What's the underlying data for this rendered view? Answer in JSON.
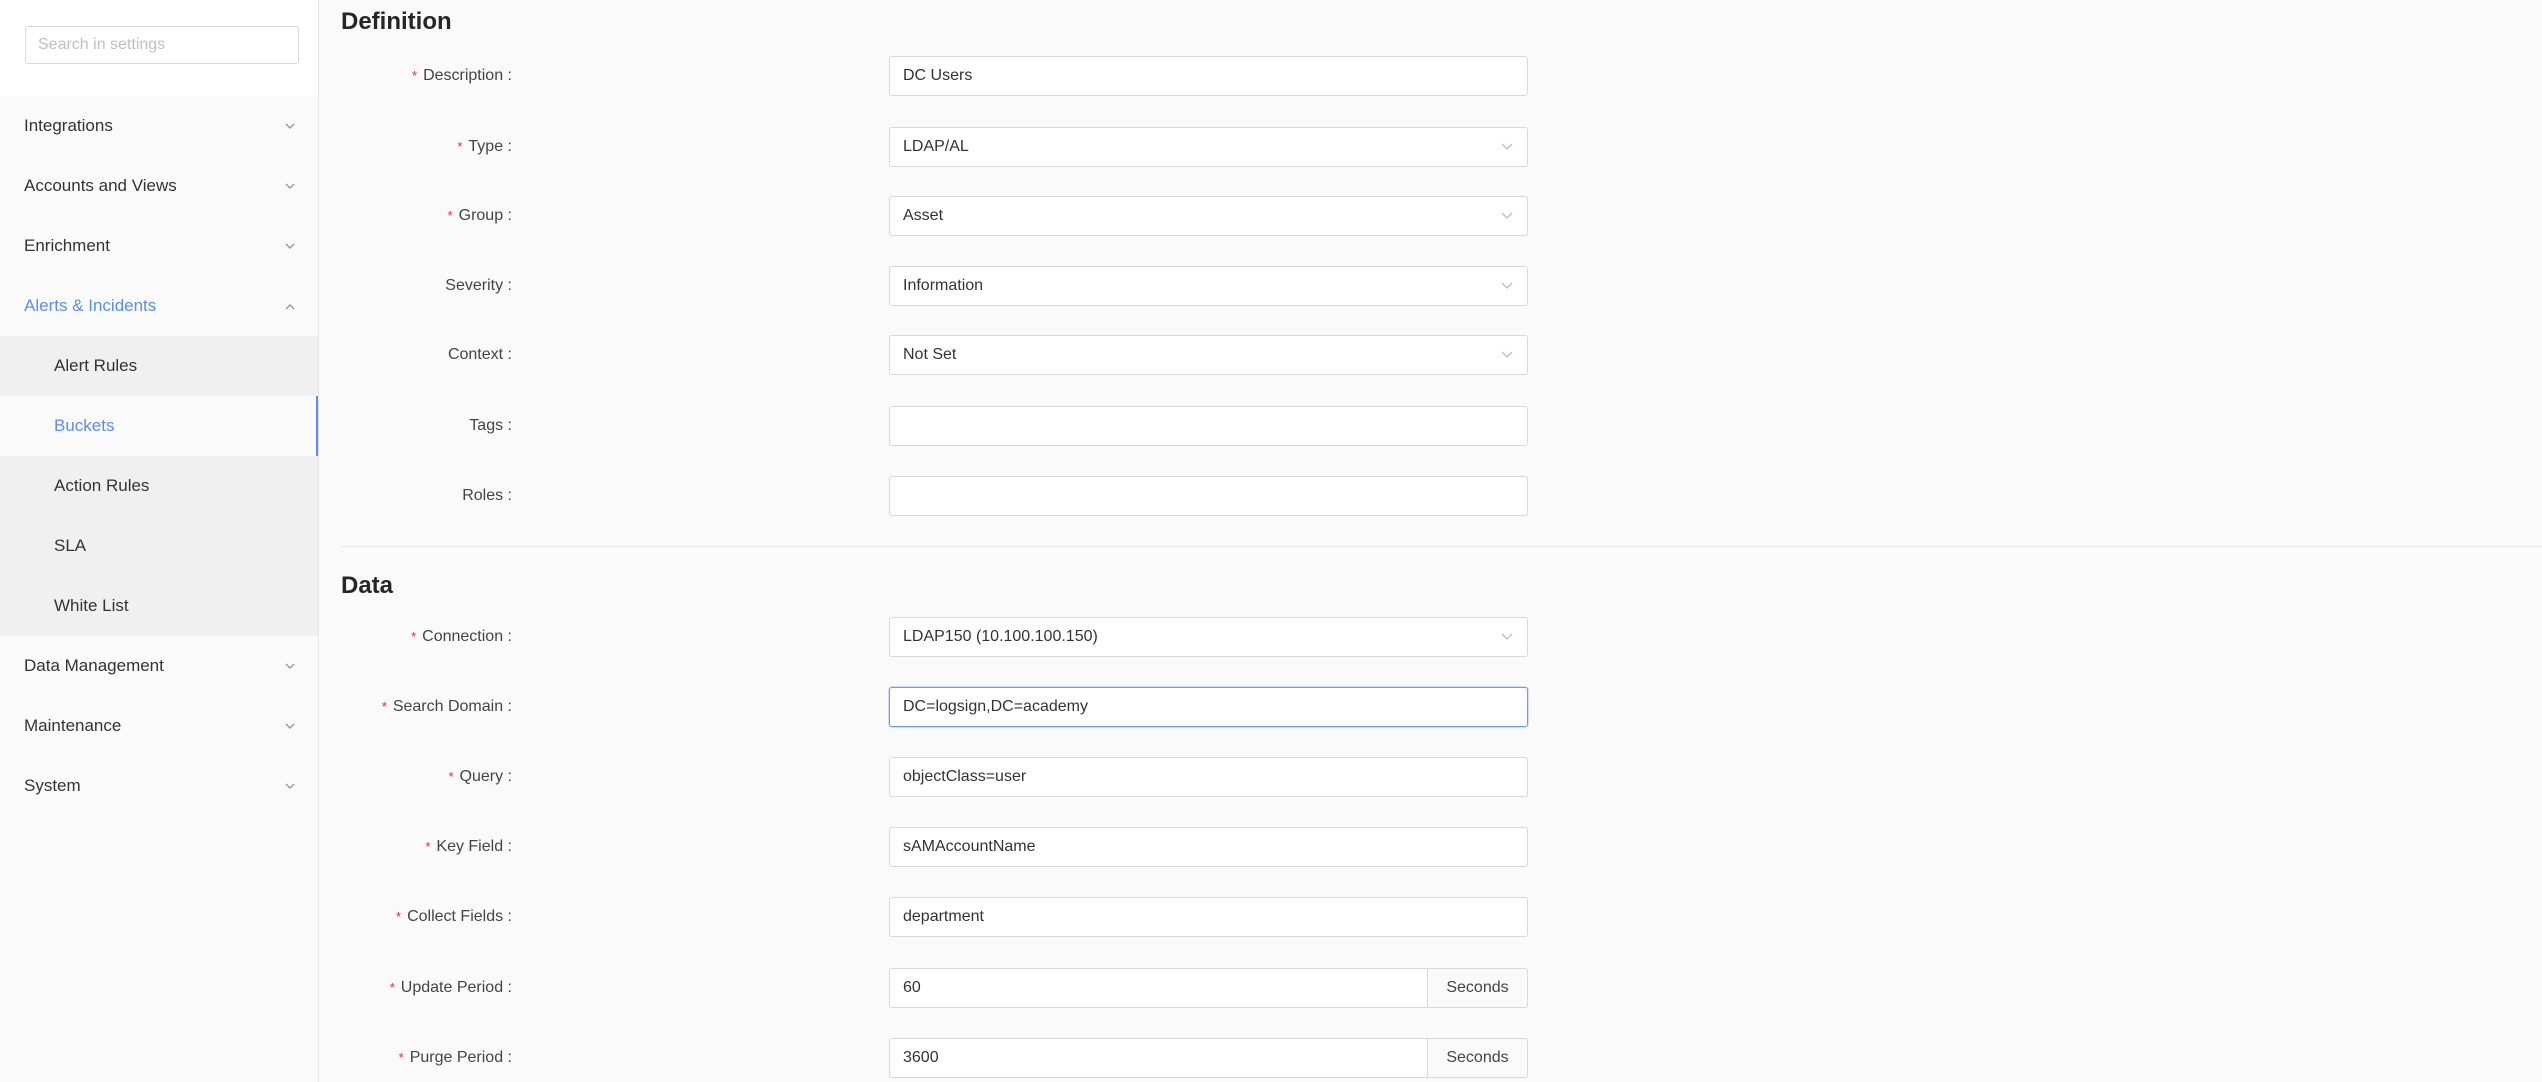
{
  "sidebar": {
    "search_placeholder": "Search in settings",
    "menu": [
      {
        "label": "Integrations"
      },
      {
        "label": "Accounts and Views"
      },
      {
        "label": "Enrichment"
      },
      {
        "label": "Alerts & Incidents"
      },
      {
        "label": "Data Management"
      },
      {
        "label": "Maintenance"
      },
      {
        "label": "System"
      }
    ],
    "submenu": [
      {
        "label": "Alert Rules"
      },
      {
        "label": "Buckets"
      },
      {
        "label": "Action Rules"
      },
      {
        "label": "SLA"
      },
      {
        "label": "White List"
      }
    ],
    "active_color": "#5b8def"
  },
  "definition": {
    "title": "Definition",
    "fields": {
      "description": {
        "label": "Description",
        "value": "DC Users"
      },
      "type": {
        "label": "Type",
        "value": "LDAP/AL"
      },
      "group": {
        "label": "Group",
        "value": "Asset"
      },
      "severity": {
        "label": "Severity",
        "value": "Information"
      },
      "context": {
        "label": "Context",
        "value": "Not Set"
      },
      "tags": {
        "label": "Tags",
        "value": ""
      },
      "roles": {
        "label": "Roles",
        "value": ""
      }
    }
  },
  "data": {
    "title": "Data",
    "fields": {
      "connection": {
        "label": "Connection",
        "value": "LDAP150 (10.100.100.150)"
      },
      "search_domain": {
        "label": "Search Domain",
        "value": "DC=logsign,DC=academy"
      },
      "query": {
        "label": "Query",
        "value": "objectClass=user"
      },
      "key_field": {
        "label": "Key Field",
        "value": "sAMAccountName"
      },
      "collect_fields": {
        "label": "Collect Fields",
        "value": "department"
      },
      "update_period": {
        "label": "Update Period",
        "value": "60",
        "unit": "Seconds"
      },
      "purge_period": {
        "label": "Purge Period",
        "value": "3600",
        "unit": "Seconds"
      }
    }
  },
  "colon": ":",
  "required_mark": "*"
}
